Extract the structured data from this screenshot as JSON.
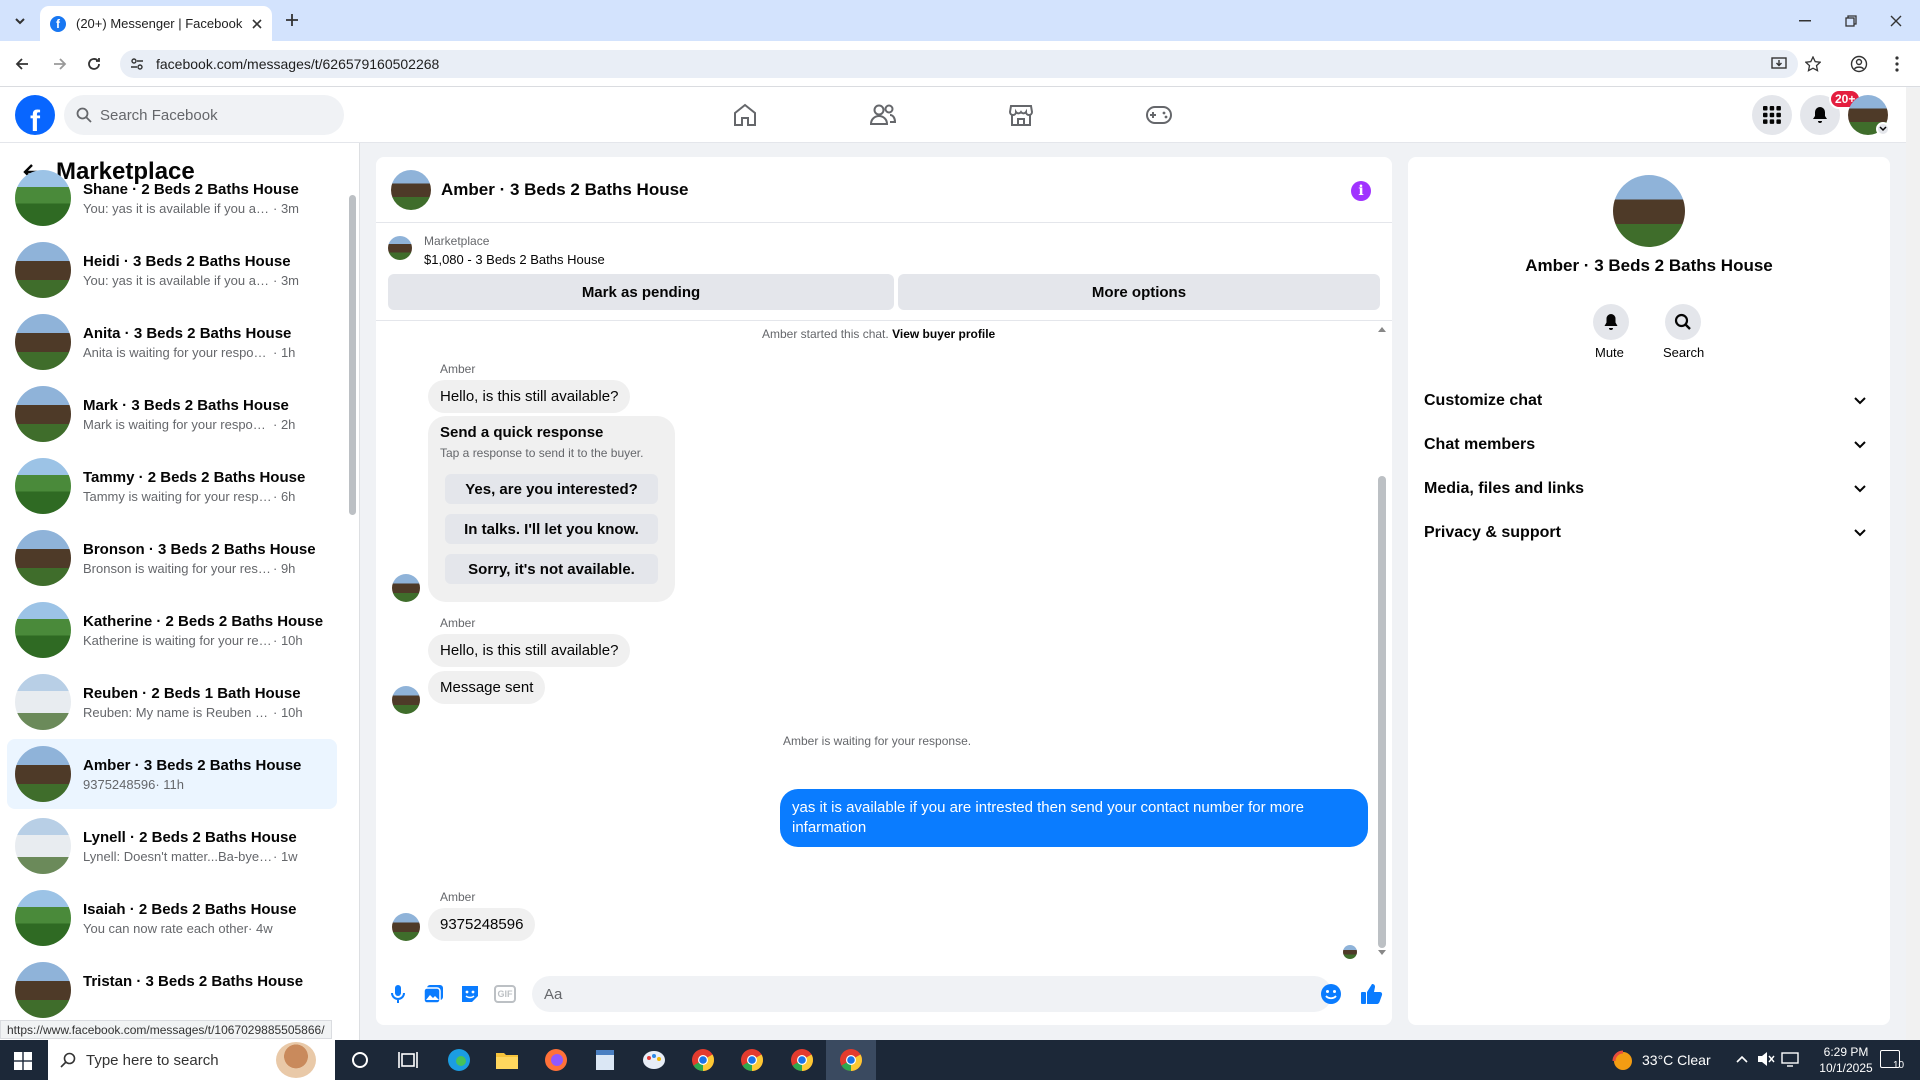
{
  "browser": {
    "tab_title": "(20+) Messenger | Facebook",
    "url": "facebook.com/messages/t/626579160502268",
    "status_url": "https://www.facebook.com/messages/t/1067029885505866/"
  },
  "facebook": {
    "search_placeholder": "Search Facebook",
    "notifications_badge": "20+"
  },
  "sidebar": {
    "title": "Marketplace",
    "conversations": [
      {
        "name": "Shane · 2 Beds 2 Baths House",
        "preview": "You: yas it is available if you are intrested then send your contact number for more infarmation",
        "time": " · 3m",
        "avatar": "green",
        "active": false
      },
      {
        "name": "Heidi · 3 Beds 2 Baths House",
        "preview": "You: yas it is available if you are intrested then send your contact number for more infarmation",
        "time": " · 3m",
        "avatar": "brown",
        "active": false
      },
      {
        "name": "Anita · 3 Beds 2 Baths House",
        "preview": "Anita is waiting for your response.",
        "time": " · 1h",
        "avatar": "brown",
        "active": false
      },
      {
        "name": "Mark · 3 Beds 2 Baths House",
        "preview": "Mark is waiting for your response.",
        "time": " · 2h",
        "avatar": "brown",
        "active": false
      },
      {
        "name": "Tammy · 2 Beds 2 Baths House",
        "preview": "Tammy is waiting for your response.",
        "time": " · 6h",
        "avatar": "green",
        "active": false
      },
      {
        "name": "Bronson · 3 Beds 2 Baths House",
        "preview": "Bronson is waiting for your response.",
        "time": " · 9h",
        "avatar": "brown",
        "active": false
      },
      {
        "name": "Katherine · 2 Beds 2 Baths House",
        "preview": "Katherine is waiting for your response.",
        "time": " · 10h",
        "avatar": "green",
        "active": false
      },
      {
        "name": "Reuben · 2 Beds 1 Bath House",
        "preview": "Reuben: My name is Reuben my name",
        "time": " · 10h",
        "avatar": "white",
        "active": false
      },
      {
        "name": "Amber · 3 Beds 2 Baths House",
        "preview": "9375248596",
        "time": " · 11h",
        "avatar": "brown",
        "active": true
      },
      {
        "name": "Lynell · 2 Beds 2 Baths House",
        "preview": "Lynell: Doesn't matter...Ba-bye Sheila",
        "time": " · 1w",
        "avatar": "white",
        "active": false
      },
      {
        "name": "Isaiah · 2 Beds 2 Baths House",
        "preview": "You can now rate each other",
        "time": " · 4w",
        "avatar": "green",
        "active": false
      },
      {
        "name": "Tristan · 3 Beds 2 Baths House",
        "preview": "",
        "time": "",
        "avatar": "brown",
        "active": false
      }
    ]
  },
  "chat": {
    "header_name": "Amber · 3 Beds 2 Baths House",
    "listing_source": "Marketplace",
    "listing_title": "$1,080 - 3 Beds 2 Baths House",
    "mark_pending": "Mark as pending",
    "more_options": "More options",
    "started_text": "Amber started this chat.",
    "view_buyer": "View buyer profile",
    "sender_1": "Amber",
    "msg_1": "Hello, is this still available?",
    "quick_title": "Send a quick response",
    "quick_sub": "Tap a response to send it to the buyer.",
    "quick_1": "Yes, are you interested?",
    "quick_2": "In talks. I'll let you know.",
    "quick_3": "Sorry, it's not available.",
    "sender_2": "Amber",
    "msg_2": "Hello, is this still available?",
    "msg_3": "Message sent",
    "waiting": "Amber is waiting for your response.",
    "my_msg": "yas it is available if you are intrested then send your contact number for more infarmation",
    "sender_3": "Amber",
    "msg_4": "9375248596",
    "composer_placeholder": "Aa"
  },
  "right": {
    "name": "Amber · 3 Beds 2 Baths House",
    "mute": "Mute",
    "search": "Search",
    "rows": [
      "Customize chat",
      "Chat members",
      "Media, files and links",
      "Privacy & support"
    ]
  },
  "taskbar": {
    "search_placeholder": "Type here to search",
    "weather": "33°C  Clear",
    "time": "6:29 PM",
    "date": "10/1/2025",
    "notif_count": "10"
  }
}
